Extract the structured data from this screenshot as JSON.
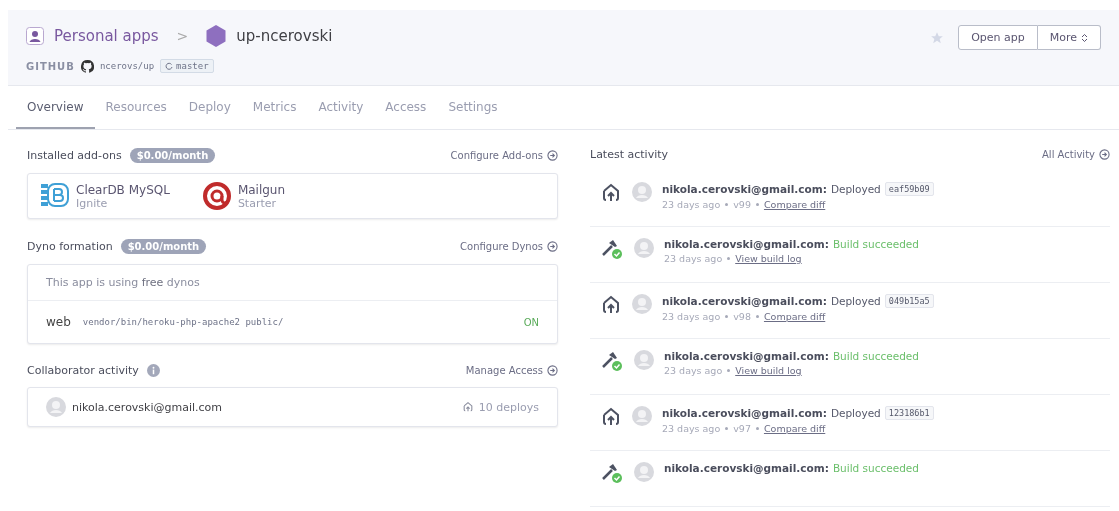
{
  "header": {
    "breadcrumb": [
      {
        "label": "Personal apps"
      },
      {
        "label": "up-ncerovski"
      }
    ],
    "separator": ">",
    "source": {
      "label": "GITHUB",
      "repo": "ncerovs/up",
      "branch": "master"
    },
    "starred": false,
    "buttons": [
      {
        "label": "Open app",
        "kind": "plain"
      },
      {
        "label": "More",
        "kind": "dropdown"
      }
    ]
  },
  "tabs": [
    {
      "label": "Overview",
      "selected": true
    },
    {
      "label": "Resources",
      "selected": false
    },
    {
      "label": "Deploy",
      "selected": false
    },
    {
      "label": "Metrics",
      "selected": false
    },
    {
      "label": "Activity",
      "selected": false
    },
    {
      "label": "Access",
      "selected": false
    },
    {
      "label": "Settings",
      "selected": false
    }
  ],
  "addons": {
    "title": "Installed add-ons",
    "price": "$0.00/month",
    "link": "Configure Add-ons",
    "items": [
      {
        "kind": "cleardb",
        "name": "ClearDB MySQL",
        "plan": "Ignite"
      },
      {
        "kind": "mailgun",
        "name": "Mailgun",
        "plan": "Starter"
      }
    ]
  },
  "dynos": {
    "title": "Dyno formation",
    "price": "$0.00/month",
    "link": "Configure Dynos",
    "note": "This app is using **free** dynos",
    "processes": [
      {
        "type": "web",
        "command": "vendor/bin/heroku-php-apache2 public/",
        "on": true,
        "status": "ON"
      }
    ]
  },
  "collaborators": {
    "title": "Collaborator activity",
    "link": "Manage Access",
    "items": [
      {
        "email": "nikola.cerovski@gmail.com",
        "deploys": "10 deploys"
      }
    ]
  },
  "activity": {
    "title": "Latest activity",
    "link": "All Activity",
    "items": [
      {
        "kind": "deploy",
        "user": "nikola.cerovski@gmail.com:",
        "action": "Deployed",
        "commit": "eaf59b09",
        "time": "23 days ago",
        "version": "v99",
        "link": "Compare diff"
      },
      {
        "kind": "build",
        "user": "nikola.cerovski@gmail.com:",
        "action": "Build succeeded",
        "time": "23 days ago",
        "link": "View build log"
      },
      {
        "kind": "deploy",
        "user": "nikola.cerovski@gmail.com:",
        "action": "Deployed",
        "commit": "049b15a5",
        "time": "23 days ago",
        "version": "v98",
        "link": "Compare diff"
      },
      {
        "kind": "build",
        "user": "nikola.cerovski@gmail.com:",
        "action": "Build succeeded",
        "time": "23 days ago",
        "link": "View build log"
      },
      {
        "kind": "deploy",
        "user": "nikola.cerovski@gmail.com:",
        "action": "Deployed",
        "commit": "123186b1",
        "time": "23 days ago",
        "version": "v97",
        "link": "Compare diff"
      },
      {
        "kind": "build",
        "user": "nikola.cerovski@gmail.com:",
        "action": "Build succeeded"
      }
    ]
  }
}
